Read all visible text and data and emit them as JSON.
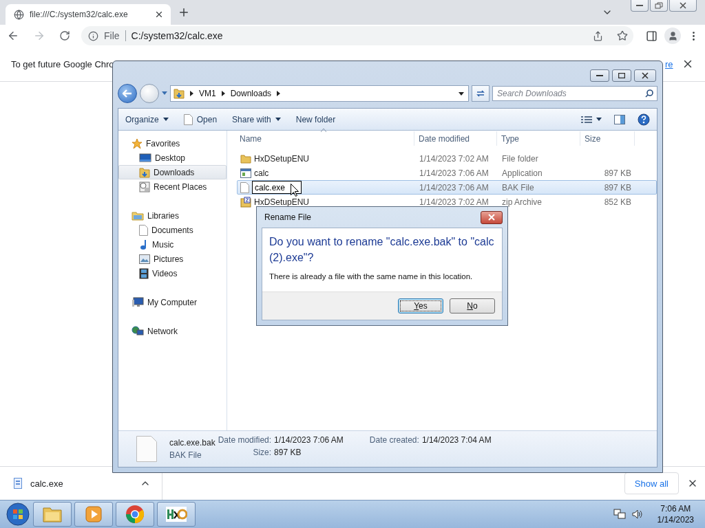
{
  "browser": {
    "tab": {
      "title": "file:///C:/system32/calc.exe"
    },
    "address": {
      "scheme": "File",
      "url": "C:/system32/calc.exe"
    },
    "banner": {
      "text": "To get future Google Chro",
      "link": "re"
    }
  },
  "explorer": {
    "breadcrumb": [
      "VM1",
      "Downloads"
    ],
    "search": {
      "placeholder": "Search Downloads"
    },
    "toolbar": [
      {
        "label": "Organize",
        "kind": "menu"
      },
      {
        "label": "Open",
        "kind": "document"
      },
      {
        "label": "Share with",
        "kind": "menu"
      },
      {
        "label": "New folder",
        "kind": "plain"
      }
    ],
    "nav": [
      {
        "label": "Favorites",
        "selected": false,
        "children": [
          {
            "label": "Desktop",
            "selected": false
          },
          {
            "label": "Downloads",
            "selected": true
          },
          {
            "label": "Recent Places",
            "selected": false
          }
        ]
      },
      {
        "label": "Libraries",
        "selected": false,
        "children": [
          {
            "label": "Documents",
            "selected": false
          },
          {
            "label": "Music",
            "selected": false
          },
          {
            "label": "Pictures",
            "selected": false
          },
          {
            "label": "Videos",
            "selected": false
          }
        ]
      },
      {
        "label": "My Computer",
        "selected": false
      },
      {
        "label": "Network",
        "selected": false
      }
    ],
    "columns": [
      "Name",
      "Date modified",
      "Type",
      "Size"
    ],
    "files": [
      {
        "name": "HxDSetupENU",
        "date": "1/14/2023 7:02 AM",
        "type": "File folder",
        "kind": "folder",
        "selected": false,
        "renaming": false
      },
      {
        "name": "calc",
        "date": "1/14/2023 7:06 AM",
        "type": "Application",
        "size": "897 KB",
        "kind": "application",
        "selected": false,
        "renaming": false
      },
      {
        "name": "calc.exe",
        "date": "1/14/2023 7:06 AM",
        "type": "BAK File",
        "size": "897 KB",
        "kind": "file",
        "selected": true,
        "renaming": true
      },
      {
        "name": "HxDSetupENU",
        "date": "1/14/2023 7:02 AM",
        "type": "zip Archive",
        "size": "852 KB",
        "kind": "archive",
        "selected": false,
        "renaming": false
      }
    ],
    "details": {
      "name": "calc.exe.bak",
      "type": "BAK File",
      "left": [
        {
          "label": "Date modified:",
          "value": "1/14/2023 7:06 AM"
        },
        {
          "label": "Size:",
          "value": "897 KB"
        }
      ],
      "right": [
        {
          "label": "Date created:",
          "value": "1/14/2023 7:04 AM"
        }
      ]
    }
  },
  "dialog": {
    "title": "Rename File",
    "question": "Do you want to rename \"calc.exe.bak\" to \"calc (2).exe\"?",
    "message": "There is already a file with the same name in this location.",
    "buttons": [
      {
        "label": "Yes",
        "selected": true
      },
      {
        "label": "No",
        "selected": false
      }
    ]
  },
  "downloads": {
    "item": "calc.exe",
    "show_all": "Show all"
  },
  "taskbar": {
    "time": "7:06 AM",
    "date": "1/14/2023"
  }
}
